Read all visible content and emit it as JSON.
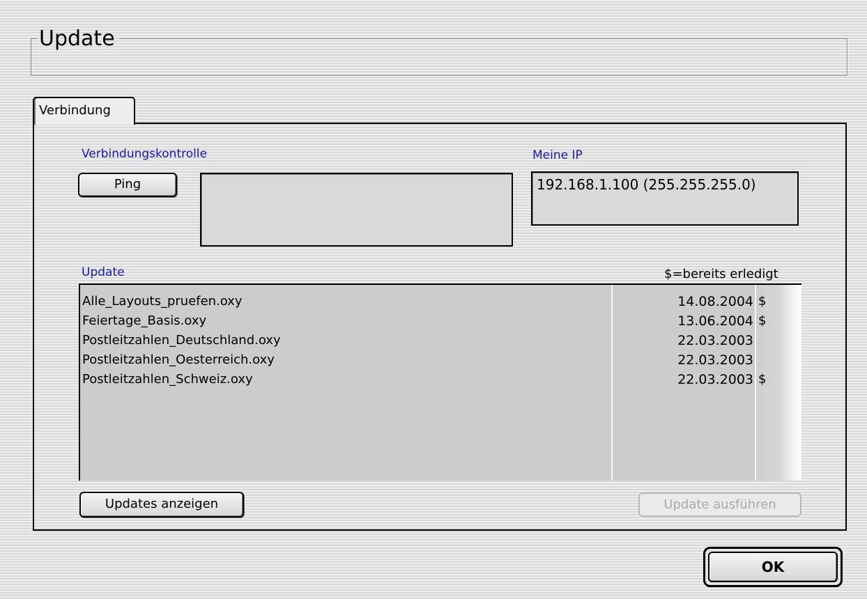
{
  "window": {
    "title": "Update"
  },
  "tabs": [
    {
      "label": "Verbindung",
      "selected": true
    }
  ],
  "connection": {
    "section_label": "Verbindungskontrolle",
    "ping_button": "Ping",
    "ping_output": "",
    "ip_label": "Meine IP",
    "ip_value": "192.168.1.100 (255.255.255.0)"
  },
  "update": {
    "section_label": "Update",
    "legend": "$=bereits erledigt",
    "items": [
      {
        "name": "Alle_Layouts_pruefen.oxy",
        "date": "14.08.2004",
        "flag": "$"
      },
      {
        "name": "Feiertage_Basis.oxy",
        "date": "13.06.2004",
        "flag": "$"
      },
      {
        "name": "Postleitzahlen_Deutschland.oxy",
        "date": "22.03.2003",
        "flag": ""
      },
      {
        "name": "Postleitzahlen_Oesterreich.oxy",
        "date": "22.03.2003",
        "flag": ""
      },
      {
        "name": "Postleitzahlen_Schweiz.oxy",
        "date": "22.03.2003",
        "flag": "$"
      }
    ],
    "show_button": "Updates anzeigen",
    "run_button": "Update ausführen",
    "run_button_enabled": false
  },
  "ok_button": "OK"
}
